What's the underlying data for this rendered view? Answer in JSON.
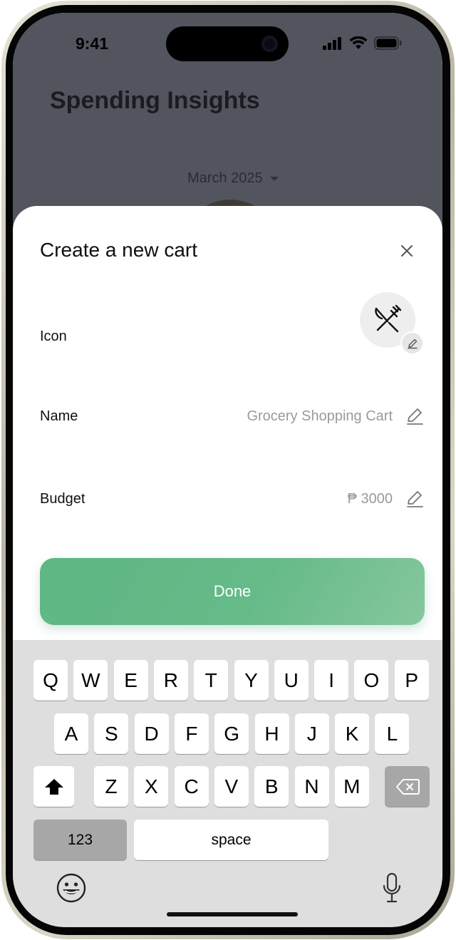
{
  "status_bar": {
    "time": "9:41"
  },
  "background_screen": {
    "title": "Spending Insights",
    "month_selector": "March 2025"
  },
  "sheet": {
    "title": "Create a new cart",
    "close_icon": "close-icon",
    "icon_row": {
      "label": "Icon",
      "icon": "fork-knife-icon",
      "edit_icon": "pencil-icon"
    },
    "name_row": {
      "label": "Name",
      "value": "Grocery Shopping Cart",
      "edit_icon": "pencil-icon"
    },
    "budget_row": {
      "label": "Budget",
      "value": "₱ 3000",
      "edit_icon": "pencil-icon"
    },
    "done_label": "Done",
    "accent_color": "#63b987"
  },
  "keyboard": {
    "row1": [
      "Q",
      "W",
      "E",
      "R",
      "T",
      "Y",
      "U",
      "I",
      "O",
      "P"
    ],
    "row2": [
      "A",
      "S",
      "D",
      "F",
      "G",
      "H",
      "J",
      "K",
      "L"
    ],
    "row3": [
      "Z",
      "X",
      "C",
      "V",
      "B",
      "N",
      "M"
    ],
    "numbers_label": "123",
    "space_label": "space",
    "shift_icon": "shift-icon",
    "backspace_icon": "backspace-icon",
    "emoji_icon": "emoji-icon",
    "mic_icon": "microphone-icon"
  }
}
